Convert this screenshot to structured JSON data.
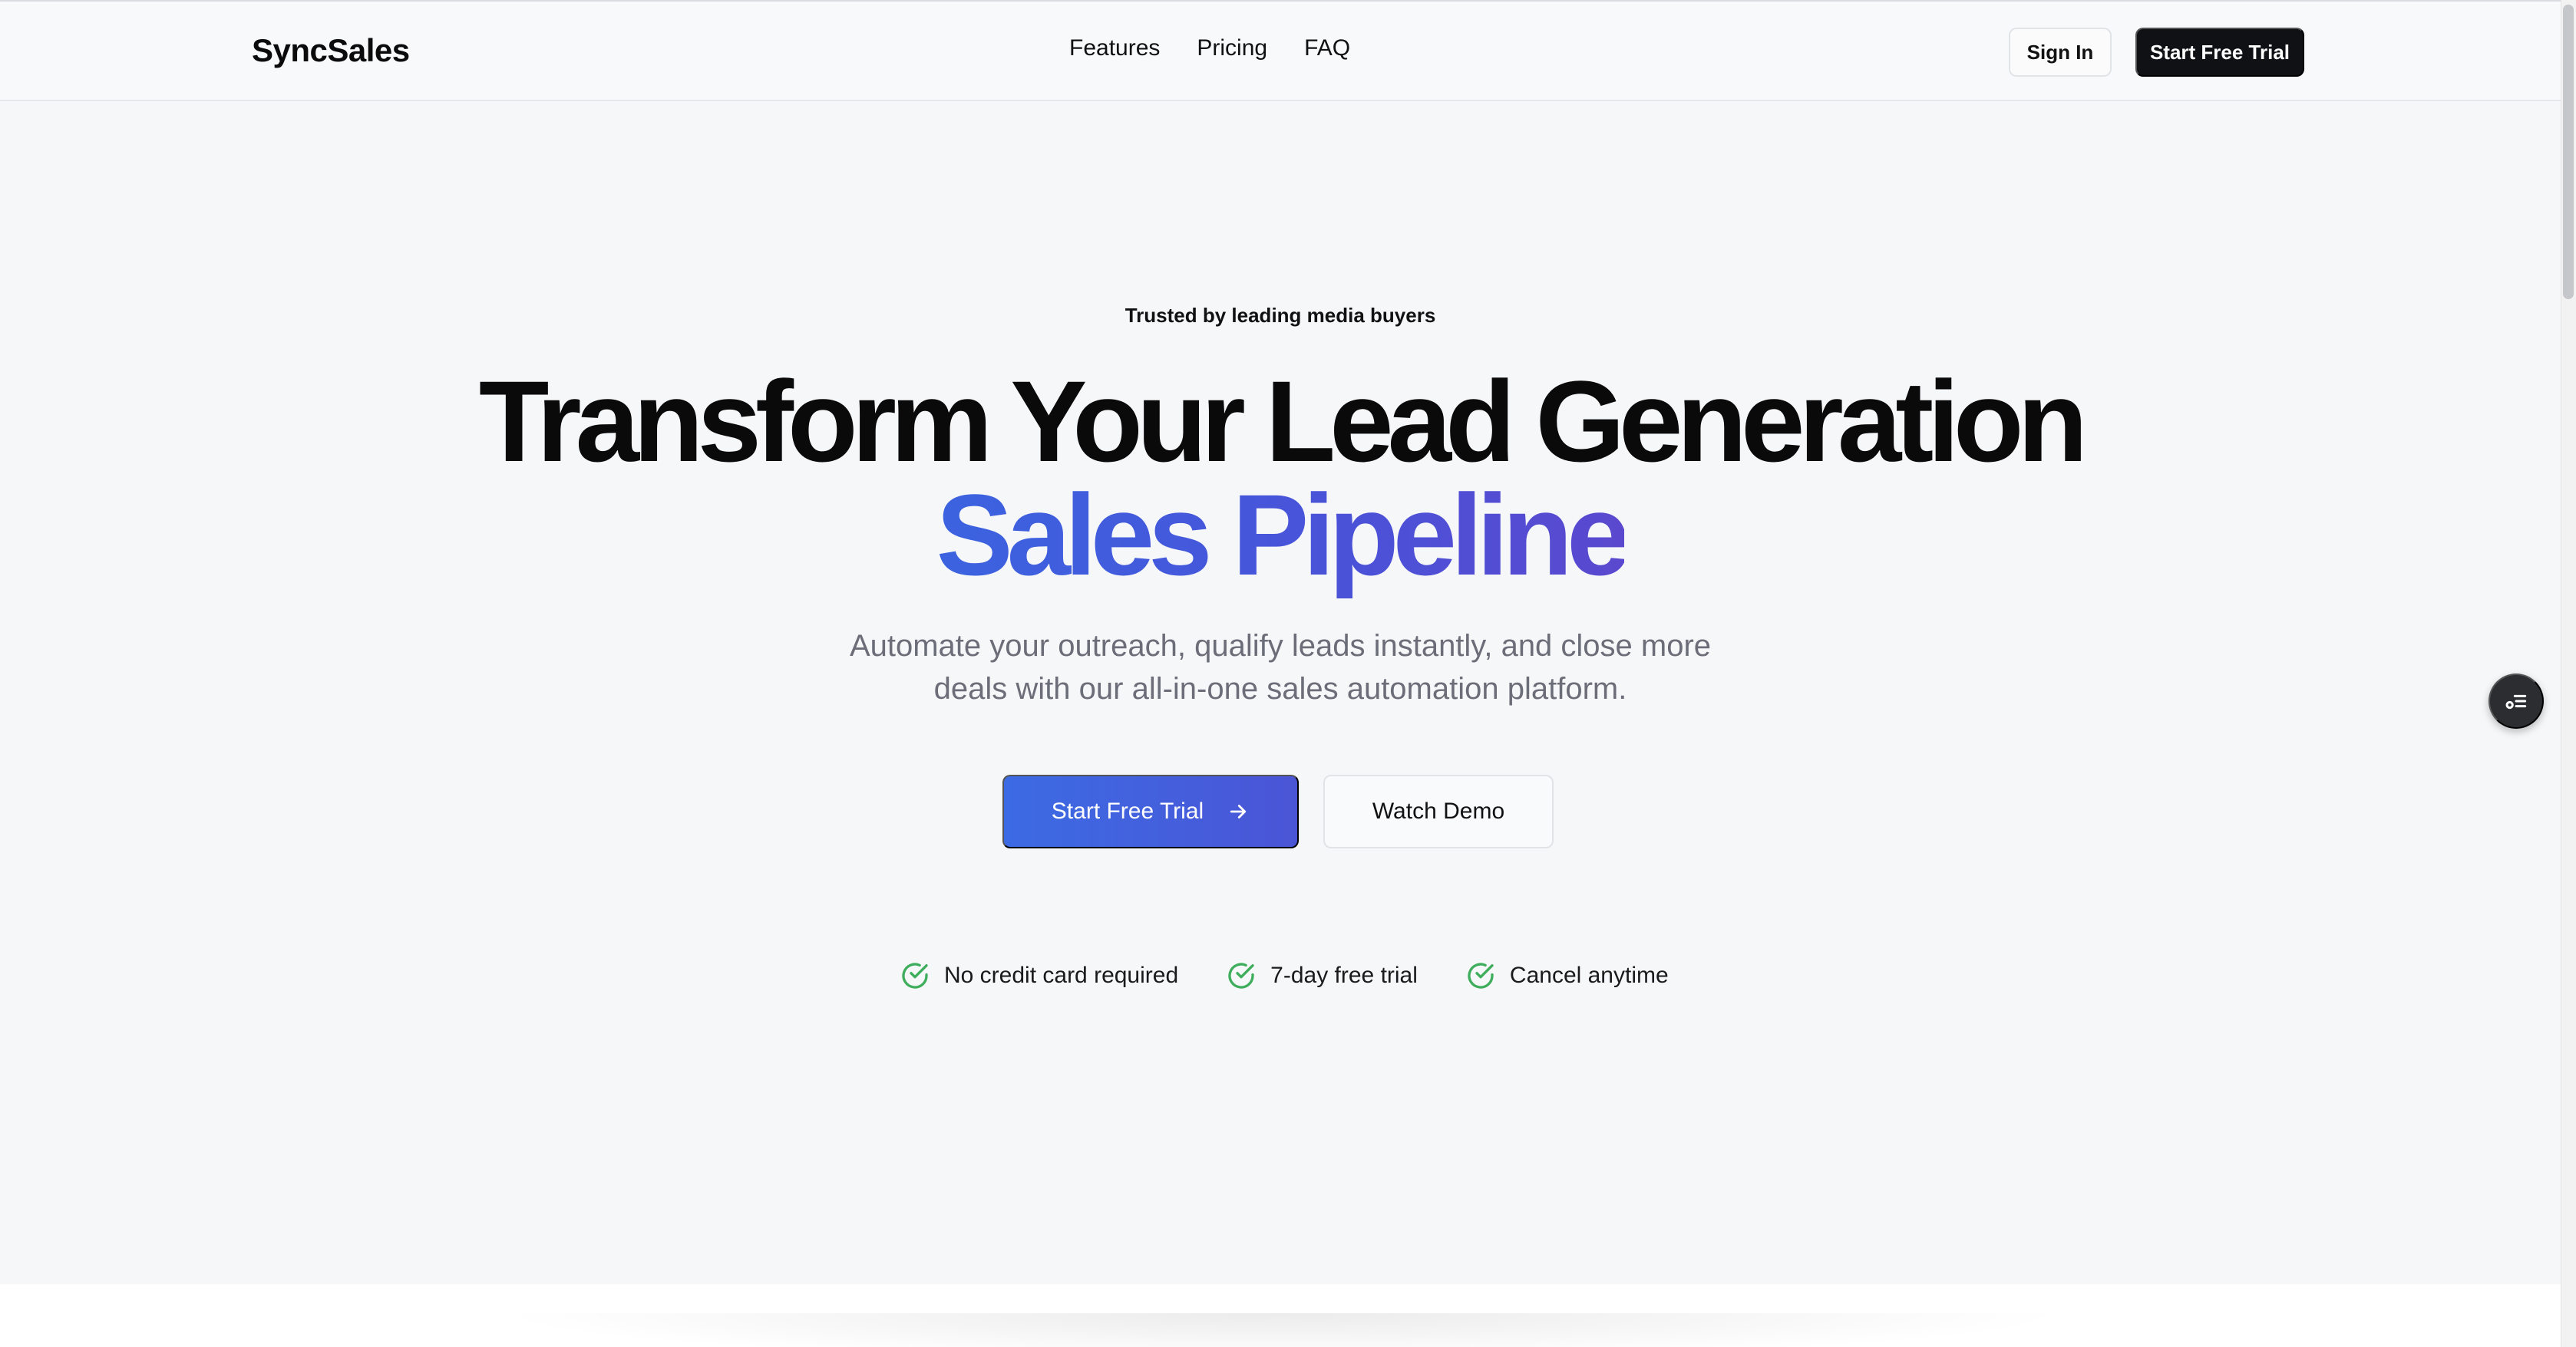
{
  "nav": {
    "brand": "SyncSales",
    "links": [
      "Features",
      "Pricing",
      "FAQ"
    ],
    "sign_in": "Sign In",
    "start_trial": "Start Free Trial"
  },
  "hero": {
    "eyebrow": "Trusted by leading media buyers",
    "headline": "Transform Your Lead Generation",
    "headline_accent": "Sales Pipeline",
    "subtitle_line1": "Automate your outreach, qualify leads instantly, and close more",
    "subtitle_line2": "deals with our all-in-one sales automation platform.",
    "primary_cta": "Start Free Trial",
    "secondary_cta": "Watch Demo",
    "perks": [
      "No credit card required",
      "7-day free trial",
      "Cancel anytime"
    ]
  },
  "colors": {
    "accent": "#3b63e0",
    "check": "#3fae5c",
    "dark_button": "#0f1115"
  },
  "icons": {
    "primary_cta_icon": "arrow-right-icon",
    "perk_icon": "check-circle-icon",
    "floating_widget_icon": "settings-list-icon"
  }
}
